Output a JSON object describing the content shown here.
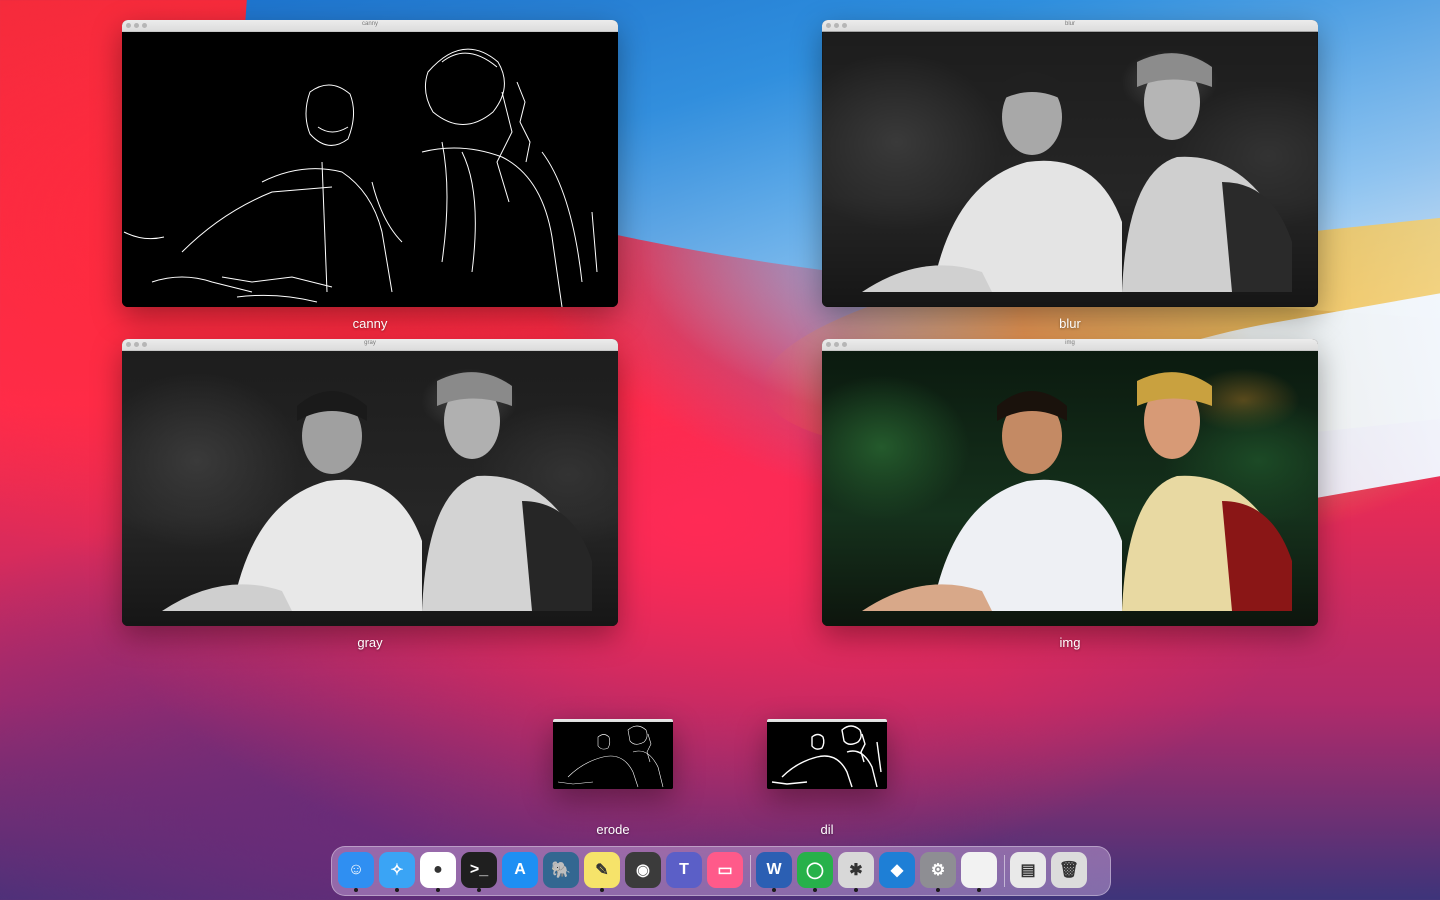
{
  "desktop": {
    "windows": [
      {
        "id": "canny",
        "title": "canny",
        "label": "canny"
      },
      {
        "id": "blur",
        "title": "blur",
        "label": "blur"
      },
      {
        "id": "gray",
        "title": "gray",
        "label": "gray"
      },
      {
        "id": "img",
        "title": "img",
        "label": "img"
      },
      {
        "id": "erode",
        "title": "",
        "label": "erode"
      },
      {
        "id": "dil",
        "title": "",
        "label": "dil"
      }
    ]
  },
  "dock": {
    "apps": [
      {
        "name": "finder-icon",
        "glyph": "☺",
        "bg": "#2f8ff2",
        "running": true
      },
      {
        "name": "safari-icon",
        "glyph": "✧",
        "bg": "#3aa4f5",
        "running": true
      },
      {
        "name": "chrome-icon",
        "glyph": "●",
        "bg": "#ffffff",
        "running": true
      },
      {
        "name": "terminal-icon",
        "glyph": ">_",
        "bg": "#1f1f1f",
        "running": true
      },
      {
        "name": "app-store-icon",
        "glyph": "A",
        "bg": "#1e8ff3",
        "running": false
      },
      {
        "name": "postgresql-icon",
        "glyph": "🐘",
        "bg": "#336791",
        "running": false
      },
      {
        "name": "stickies-icon",
        "glyph": "✎",
        "bg": "#f6e36a",
        "running": true
      },
      {
        "name": "screenshot-icon",
        "glyph": "◉",
        "bg": "#3b3b3b",
        "running": false
      },
      {
        "name": "teams-icon",
        "glyph": "T",
        "bg": "#5b5fc7",
        "running": false
      },
      {
        "name": "cleanmymac-icon",
        "glyph": "▭",
        "bg": "#ff5a8a",
        "running": false
      },
      {
        "name": "word-icon",
        "glyph": "W",
        "bg": "#2b5fb3",
        "running": true
      },
      {
        "name": "circle-app-icon",
        "glyph": "◯",
        "bg": "#27b14a",
        "running": true
      },
      {
        "name": "spider-icon",
        "glyph": "✱",
        "bg": "#d8d8d8",
        "running": true
      },
      {
        "name": "azure-studio-icon",
        "glyph": "◆",
        "bg": "#1e7fd6",
        "running": false
      },
      {
        "name": "system-preferences-icon",
        "glyph": "⚙",
        "bg": "#8e8e93",
        "running": true
      },
      {
        "name": "document-icon",
        "glyph": "",
        "bg": "#f2f2f2",
        "running": true
      },
      {
        "name": "files-icon",
        "glyph": "▤",
        "bg": "#e9e9e9",
        "running": false
      },
      {
        "name": "trash-icon",
        "glyph": "🗑",
        "bg": "#dcdcdc",
        "running": false
      }
    ]
  }
}
